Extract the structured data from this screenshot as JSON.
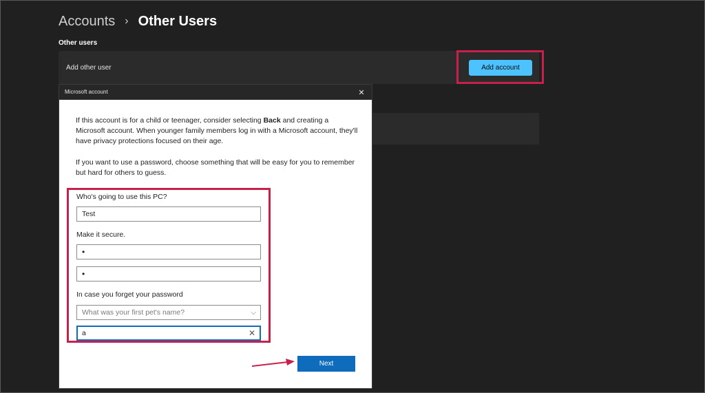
{
  "breadcrumb": {
    "parent": "Accounts",
    "separator": "›",
    "current": "Other Users"
  },
  "section": {
    "title": "Other users"
  },
  "add_user_card": {
    "label": "Add other user",
    "button": "Add account"
  },
  "dialog": {
    "title": "Microsoft account",
    "close_icon": "close-icon",
    "para1_before": "If this account is for a child or teenager, consider selecting ",
    "para1_bold": "Back",
    "para1_after": " and creating a Microsoft account. When younger family members log in with a Microsoft account, they'll have privacy protections focused on their age.",
    "para2": "If you want to use a password, choose something that will be easy for you to remember but hard for others to guess.",
    "user_label": "Who's going to use this PC?",
    "user_value": "Test",
    "secure_label": "Make it secure.",
    "password_value": "•",
    "confirm_value": "•",
    "forget_label": "In case you forget your password",
    "question_placeholder": "What was your first pet's name?",
    "answer_value": "a",
    "next_label": "Next"
  },
  "colors": {
    "accent": "#4cc2ff",
    "highlight": "#c8204a",
    "primary": "#0f6cbd"
  }
}
